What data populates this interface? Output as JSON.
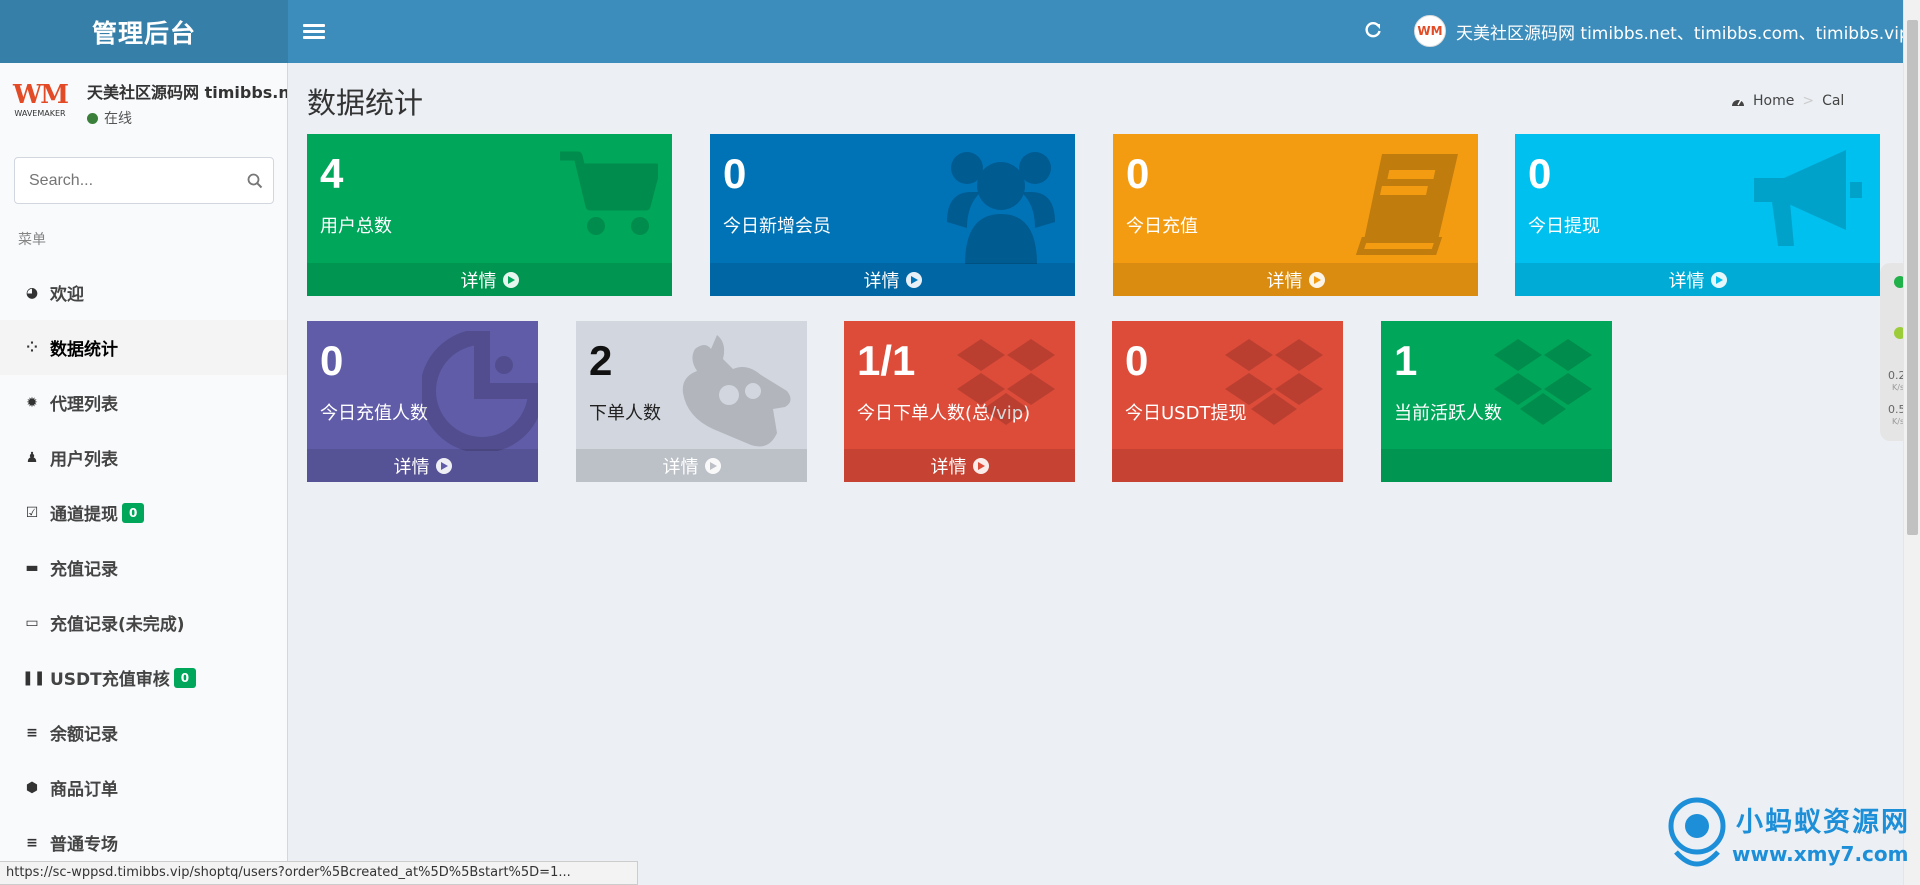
{
  "header": {
    "app_title": "管理后台",
    "user_name": "天美社区源码网 timibbs.net、timibbs.com、timibbs.vip",
    "avatar_text": "WM"
  },
  "sidebar": {
    "logo_text": "WM",
    "logo_sub": "WAVEMAKER",
    "site_name": "天美社区源码网 timibbs.net",
    "status": "在线",
    "search_placeholder": "Search...",
    "menu_header": "菜单",
    "items": [
      {
        "label": "欢迎",
        "icon": "dashboard-icon",
        "glyph": "◕"
      },
      {
        "label": "数据统计",
        "icon": "grid-dots-icon",
        "glyph": "⁘",
        "active": true
      },
      {
        "label": "代理列表",
        "icon": "gear-icon",
        "glyph": "✹"
      },
      {
        "label": "用户列表",
        "icon": "user-icon",
        "glyph": "♟"
      },
      {
        "label": "通道提现",
        "icon": "checkbox-icon",
        "glyph": "☑",
        "badge": "0"
      },
      {
        "label": "充值记录",
        "icon": "battery-icon",
        "glyph": "▬"
      },
      {
        "label": "充值记录(未完成)",
        "icon": "battery-empty-icon",
        "glyph": "▭"
      },
      {
        "label": "USDT充值审核",
        "icon": "pause-icon",
        "glyph": "❚❚",
        "badge": "0"
      },
      {
        "label": "余额记录",
        "icon": "list-icon",
        "glyph": "≡"
      },
      {
        "label": "商品订单",
        "icon": "hexagon-icon",
        "glyph": "⬢"
      },
      {
        "label": "普通专场",
        "icon": "list-icon",
        "glyph": "≡"
      }
    ]
  },
  "content": {
    "title": "数据统计",
    "breadcrumb": {
      "home": "Home",
      "separator": ">",
      "current": "Cal"
    }
  },
  "stats": [
    {
      "value": "4",
      "label": "用户总数",
      "footer": "详情",
      "color": "#00a65a",
      "icon": "cart-icon"
    },
    {
      "value": "0",
      "label": "今日新增会员",
      "footer": "详情",
      "color": "#0073b7",
      "icon": "users-icon"
    },
    {
      "value": "0",
      "label": "今日充值",
      "footer": "详情",
      "color": "#f39c12",
      "icon": "book-icon"
    },
    {
      "value": "0",
      "label": "今日提现",
      "footer": "详情",
      "color": "#00c0ef",
      "icon": "megaphone-icon"
    },
    {
      "value": "0",
      "label": "今日充值人数",
      "footer": "详情",
      "color": "#605ca8",
      "icon": "pacman-icon"
    },
    {
      "value": "2",
      "label": "下单人数",
      "footer": "详情",
      "color": "#d2d6de",
      "icon": "sign-language-icon"
    },
    {
      "value": "1/1",
      "label": "今日下单人数(总/vip)",
      "footer": "详情",
      "color": "#dd4b39",
      "icon": "dropbox-icon"
    },
    {
      "value": "0",
      "label": "今日USDT提现",
      "footer": "",
      "color": "#dd4b39",
      "icon": "dropbox-icon"
    },
    {
      "value": "1",
      "label": "当前活跃人数",
      "footer": "",
      "color": "#00a65a",
      "icon": "dropbox-icon"
    }
  ],
  "netwidget": {
    "up": "0.2",
    "up_unit": "K/s",
    "down": "0.5",
    "down_unit": "K/s"
  },
  "statusbar": {
    "url": "https://sc-wppsd.timibbs.vip/shoptq/users?order%5Bcreated_at%5D%5Bstart%5D=1..."
  },
  "watermark": {
    "line1": "小蚂蚁资源网",
    "line2": "www.xmy7.com"
  }
}
